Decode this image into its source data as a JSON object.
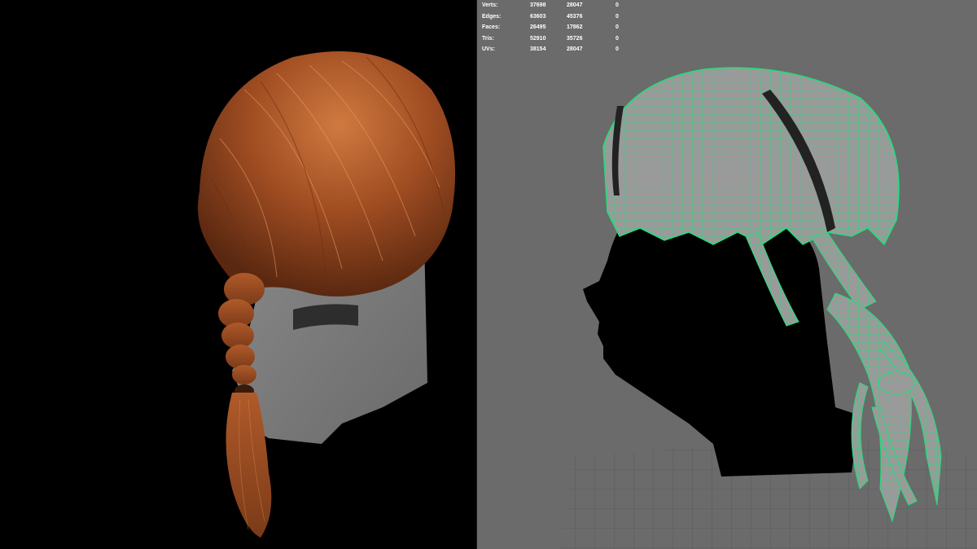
{
  "hud": {
    "rows": [
      {
        "label": "Verts:",
        "total": "37698",
        "selected": "28047",
        "extra": "0"
      },
      {
        "label": "Edges:",
        "total": "63603",
        "selected": "45376",
        "extra": "0"
      },
      {
        "label": "Faces:",
        "total": "26495",
        "selected": "17862",
        "extra": "0"
      },
      {
        "label": "Tris:",
        "total": "52910",
        "selected": "35726",
        "extra": "0"
      },
      {
        "label": "UVs:",
        "total": "38154",
        "selected": "28047",
        "extra": "0"
      }
    ]
  },
  "colors": {
    "viewport_background": "#6b6b6b",
    "wireframe_selected": "#1fe07a",
    "hair_render": "#b0582a",
    "head_render": "#7a7a7a"
  }
}
